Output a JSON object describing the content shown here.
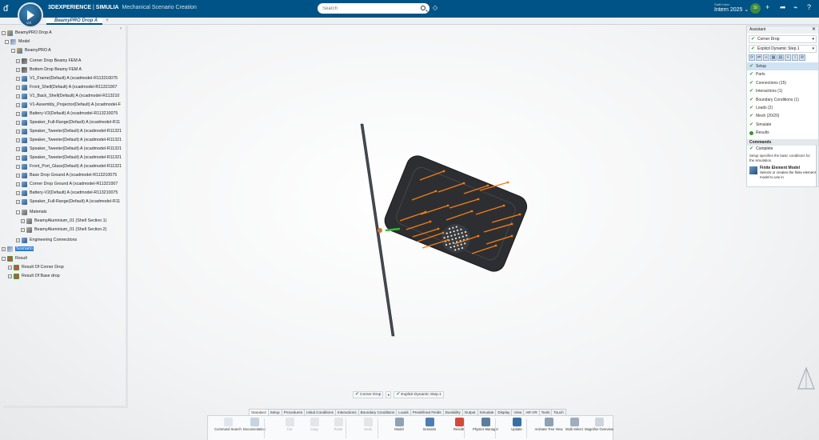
{
  "header": {
    "brand_bold": "3DEXPERIENCE",
    "brand_sep": " | ",
    "brand_app": "SIMULIA",
    "brand_sub": "Mechanical Scenario Creation",
    "version": "V.R",
    "search_placeholder": "Search",
    "user_role": "Staff Intern",
    "user_name": "Intern 2025",
    "avatar_initials": "SI"
  },
  "tabs": [
    {
      "label": "BeamyPRO Drop A"
    }
  ],
  "tree": {
    "rows": [
      {
        "label": "BeamyPRO Drop A",
        "icon": "product-icon"
      },
      {
        "label": "Model",
        "icon": "model-icon"
      },
      {
        "label": "BeamyPRO A",
        "icon": "product-icon"
      },
      {
        "label": "Corner Drop Beamy FEM A",
        "icon": "fem-icon"
      },
      {
        "label": "Bottom Drop Beamy FEM A",
        "icon": "fem-icon"
      },
      {
        "label": "V1_Frame(Default) A (xcadmodel-R113210075",
        "icon": "part-icon"
      },
      {
        "label": "Front_Shell(Default) A (xcadmodel-R11321007",
        "icon": "part-icon"
      },
      {
        "label": "V1_Back_Shell(Default) A (xcadmodel-R113210",
        "icon": "part-icon"
      },
      {
        "label": "V1-Assembly_Projector(Default) A (xcadmodel-F",
        "icon": "part-icon"
      },
      {
        "label": "Battery-V2(Default) A (xcadmodel-R113210075",
        "icon": "part-icon"
      },
      {
        "label": "Speaker_Full-Range(Default) A (xcadmodel-R11",
        "icon": "part-icon"
      },
      {
        "label": "Speaker_Tweeter(Default) A (xcadmodel-R11321",
        "icon": "part-icon"
      },
      {
        "label": "Speaker_Tweeter(Default) A (xcadmodel-R11321",
        "icon": "part-icon"
      },
      {
        "label": "Speaker_Tweeter(Default) A (xcadmodel-R11321",
        "icon": "part-icon"
      },
      {
        "label": "Speaker_Tweeter(Default) A (xcadmodel-R11321",
        "icon": "part-icon"
      },
      {
        "label": "Front_Port_Glass(Default) A (xcadmodel-R11321",
        "icon": "part-icon"
      },
      {
        "label": "Base Drop Ground A (xcadmodel-R113210075",
        "icon": "part-icon"
      },
      {
        "label": "Corner Drop Ground A (xcadmodel-R11321007",
        "icon": "part-icon"
      },
      {
        "label": "Battery-V2(Default) A (xcadmodel-R113210075",
        "icon": "part-icon"
      },
      {
        "label": "Speaker_Full-Range(Default) A (xcadmodel-R11",
        "icon": "part-icon"
      },
      {
        "label": "Materials",
        "icon": "materials-icon"
      },
      {
        "label": "BeamyAluminium_01 (Shell Section.1)",
        "icon": "material-icon"
      },
      {
        "label": "BeamyAluminium_01 (Shell Section.2)",
        "icon": "material-icon"
      },
      {
        "label": "Engineering Connections",
        "icon": "connections-icon"
      },
      {
        "label": "Scenario",
        "icon": "scenario-icon"
      },
      {
        "label": "Result",
        "icon": "result-icon"
      },
      {
        "label": "Result Of Corner Drop",
        "icon": "result-item-icon"
      },
      {
        "label": "Result Of Base drop",
        "icon": "result-item-icon"
      }
    ]
  },
  "assistant": {
    "title": "Assistant",
    "case": "Corner Drop",
    "step": "Explicit Dynamic Step.1",
    "steps": [
      {
        "label": "Setup",
        "done": true
      },
      {
        "label": "Parts",
        "done": true
      },
      {
        "label": "Connections (15)",
        "done": true
      },
      {
        "label": "Interactions (1)",
        "done": true
      },
      {
        "label": "Boundary Conditions (1)",
        "done": true
      },
      {
        "label": "Loads (2)",
        "done": true
      },
      {
        "label": "Mesh (20/20)",
        "done": true
      },
      {
        "label": "Simulate",
        "done": true
      },
      {
        "label": "Results",
        "done": false
      }
    ],
    "commands_title": "Commands",
    "command_complete": "Complete",
    "setup_desc": "Setup specifies the basic conditions for the simulation.",
    "fe_title": "Finite Element Model",
    "fe_desc": "Selects or creates the finite element model to use in"
  },
  "stepbar": {
    "case": "Corner Drop",
    "step": "Explicit Dynamic Step.1"
  },
  "action_tabs": [
    "Standard",
    "Setup",
    "Procedures",
    "Initial Conditions",
    "Interactions",
    "Boundary Conditions",
    "Loads",
    "Predefined Fields",
    "Durability",
    "Output",
    "Simulate",
    "Display",
    "View",
    "AR-VR",
    "Tools",
    "Touch"
  ],
  "commands": [
    {
      "label": "Command Search"
    },
    {
      "label": "Documentation"
    },
    {
      "label": "Cut"
    },
    {
      "label": "Copy"
    },
    {
      "label": "Paste"
    },
    {
      "label": "Undo"
    },
    {
      "label": "Model"
    },
    {
      "label": "Scenario"
    },
    {
      "label": "Results"
    },
    {
      "label": "Physics Manager"
    },
    {
      "label": "Update"
    },
    {
      "label": "Animate Tree View"
    },
    {
      "label": "Multi Select"
    },
    {
      "label": "Magnifier Overview"
    }
  ],
  "colors": {
    "header": "#005386",
    "load_arrow": "#f07d14",
    "boundary": "#2fbf2f",
    "check": "#2f9a2f"
  }
}
